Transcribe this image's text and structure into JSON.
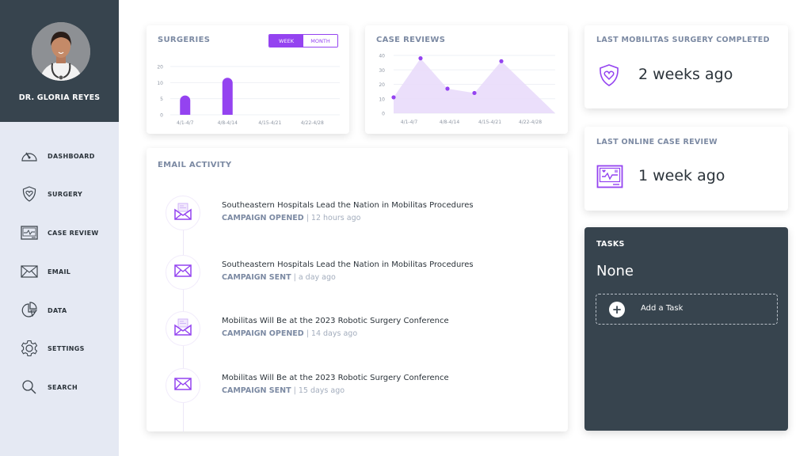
{
  "colors": {
    "accent": "#9443f0",
    "accent_fill": "#e9dcfb",
    "sidebar_bg": "#e5e9f3",
    "dark_panel": "#37444e",
    "muted_text": "#7c8aa3"
  },
  "profile": {
    "name": "DR. GLORIA REYES",
    "avatar_icon": "doctor-portrait"
  },
  "sidebar": {
    "items": [
      {
        "label": "DASHBOARD",
        "icon": "dashboard-gauge-icon"
      },
      {
        "label": "SURGERY",
        "icon": "shield-heart-icon"
      },
      {
        "label": "CASE REVIEW",
        "icon": "monitor-pulse-icon"
      },
      {
        "label": "EMAIL",
        "icon": "envelope-icon"
      },
      {
        "label": "DATA",
        "icon": "pie-chart-icon"
      },
      {
        "label": "SETTINGS",
        "icon": "gear-icon"
      },
      {
        "label": "SEARCH",
        "icon": "search-icon"
      }
    ]
  },
  "surgeries": {
    "title": "SURGERIES",
    "toggle": {
      "week": "WEEK",
      "month": "MONTH",
      "selected": "WEEK"
    }
  },
  "case_reviews": {
    "title": "CASE REVIEWS"
  },
  "chart_data": [
    {
      "type": "bar",
      "title": "SURGERIES",
      "categories": [
        "4/1-4/7",
        "4/8-4/14",
        "4/15-4/21",
        "4/22-4/28"
      ],
      "values": [
        6,
        13,
        0,
        0
      ],
      "yticks": [
        "0",
        "5",
        "10",
        "20"
      ],
      "ytick_values": [
        0,
        5,
        10,
        20
      ],
      "ylim": [
        0,
        20
      ],
      "grid": true,
      "xlabel": "",
      "ylabel": ""
    },
    {
      "type": "area",
      "title": "CASE REVIEWS",
      "categories": [
        "4/1-4/7",
        "4/8-4/14",
        "4/15-4/21",
        "4/22-4/28"
      ],
      "x": [
        0,
        1,
        2,
        3,
        4,
        5,
        6
      ],
      "values": [
        11,
        38,
        17,
        14,
        36,
        null,
        0
      ],
      "points": [
        {
          "x": 0,
          "y": 11
        },
        {
          "x": 1,
          "y": 38
        },
        {
          "x": 2,
          "y": 17
        },
        {
          "x": 3,
          "y": 14
        },
        {
          "x": 4,
          "y": 36
        },
        {
          "x": 6,
          "y": 0
        }
      ],
      "yticks": [
        "0",
        "10",
        "20",
        "30",
        "40"
      ],
      "ylim": [
        0,
        40
      ],
      "grid": true,
      "xlabel": "",
      "ylabel": ""
    }
  ],
  "last_surgery": {
    "title": "LAST MOBILITAS SURGERY COMPLETED",
    "value": "2 weeks ago",
    "icon": "shield-heart-icon"
  },
  "last_case_review": {
    "title": "LAST ONLINE CASE REVIEW",
    "value": "1 week ago",
    "icon": "monitor-pulse-icon"
  },
  "email_activity": {
    "title": "EMAIL ACTIVITY",
    "items": [
      {
        "title": "Southeastern Hospitals Lead the Nation in Mobilitas Procedures",
        "kind": "CAMPAIGN OPENED",
        "time": "| 12 hours ago",
        "icon": "envelope-open-icon"
      },
      {
        "title": "Southeastern Hospitals Lead the Nation in Mobilitas Procedures",
        "kind": "CAMPAIGN SENT",
        "time": "| a day ago",
        "icon": "envelope-icon"
      },
      {
        "title": "Mobilitas Will Be at the 2023 Robotic Surgery Conference",
        "kind": "CAMPAIGN OPENED",
        "time": "| 14 days ago",
        "icon": "envelope-open-icon"
      },
      {
        "title": "Mobilitas Will Be at the 2023 Robotic Surgery Conference",
        "kind": "CAMPAIGN SENT",
        "time": "| 15 days ago",
        "icon": "envelope-icon"
      }
    ]
  },
  "tasks": {
    "title": "TASKS",
    "status": "None",
    "add_label": "Add a Task",
    "add_icon": "plus-circle-icon"
  }
}
